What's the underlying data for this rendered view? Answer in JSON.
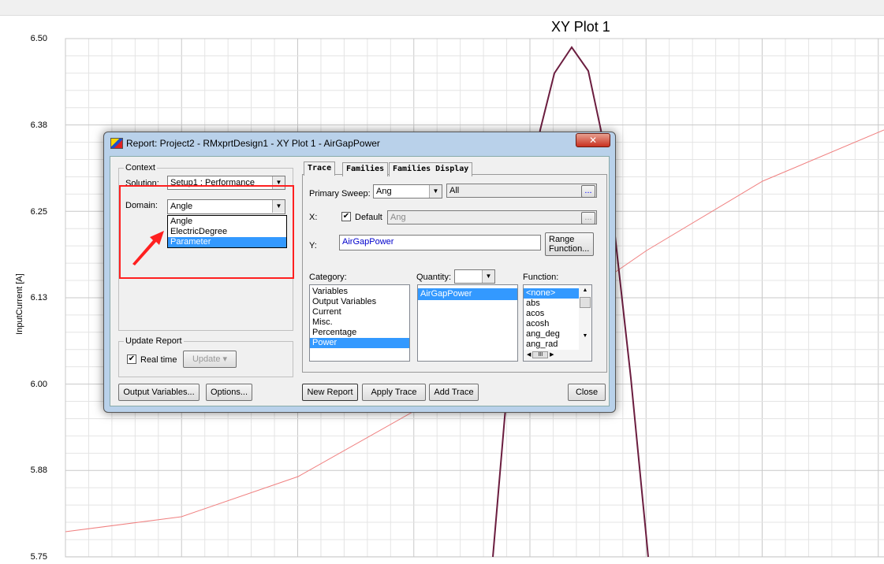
{
  "plot": {
    "title": "XY Plot 1",
    "ylabel": "InputCurrent [A]",
    "yticks": [
      "6.50",
      "6.38",
      "6.25",
      "6.13",
      "6.00",
      "5.88",
      "5.75"
    ]
  },
  "dialog": {
    "title": "Report: Project2 - RMxprtDesign1 - XY Plot 1 - AirGapPower",
    "close_glyph": "✕",
    "context": {
      "legend": "Context",
      "solution_label": "Solution:",
      "solution_value": "Setup1 : Performance",
      "domain_label": "Domain:",
      "domain_value": "Angle",
      "domain_options": [
        "Angle",
        "ElectricDegree",
        "Parameter"
      ],
      "highlighted_option": "Parameter"
    },
    "update": {
      "legend": "Update Report",
      "realtime_label": "Real time",
      "realtime_checked": true,
      "update_button": "Update"
    },
    "tabs": [
      "Trace",
      "Families",
      "Families Display"
    ],
    "trace": {
      "primary_sweep_label": "Primary Sweep:",
      "primary_sweep_value": "Ang",
      "sweep_range": "All",
      "ellipsis": "...",
      "x_label": "X:",
      "default_label": "Default",
      "default_checked": true,
      "x_value": "Ang",
      "y_label": "Y:",
      "y_value": "AirGapPower",
      "range_function_line1": "Range",
      "range_function_line2": "Function...",
      "category_label": "Category:",
      "categories": [
        "Variables",
        "Output Variables",
        "Current",
        "Misc.",
        "Percentage",
        "Power"
      ],
      "selected_category": "Power",
      "quantity_label": "Quantity:",
      "quantities": [
        "AirGapPower"
      ],
      "function_label": "Function:",
      "functions": [
        "<none>",
        "abs",
        "acos",
        "acosh",
        "ang_deg",
        "ang_rad"
      ]
    },
    "buttons": {
      "output_variables": "Output Variables...",
      "options": "Options...",
      "new_report": "New Report",
      "apply_trace": "Apply Trace",
      "add_trace": "Add Trace",
      "close": "Close"
    }
  },
  "colors": {
    "highlight": "#3399ff",
    "annotation": "#ff2020",
    "curve1": "#6b1d3f",
    "curve2": "#f08080"
  }
}
